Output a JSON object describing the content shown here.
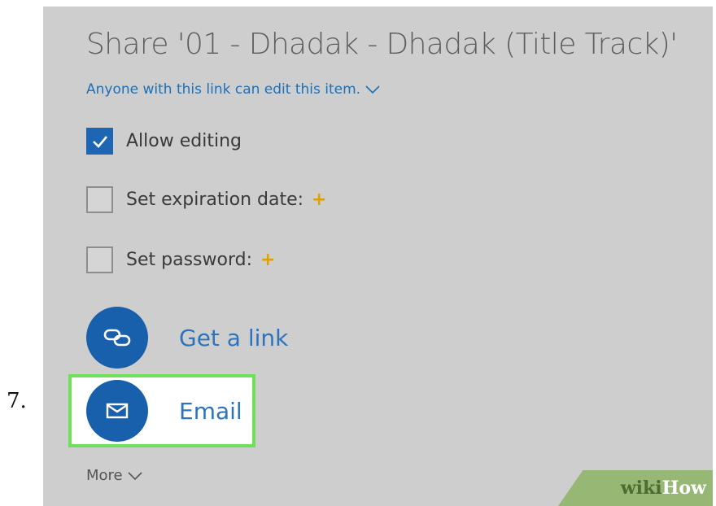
{
  "step_number": "7.",
  "dialog": {
    "title": "Share '01 - Dhadak - Dhadak (Title Track)'",
    "permission_text": "Anyone with this link can edit this item.",
    "options": [
      {
        "label": "Allow editing",
        "checked": true
      },
      {
        "label": "Set expiration date:",
        "checked": false,
        "premium": "+"
      },
      {
        "label": "Set password:",
        "checked": false,
        "premium": "+"
      }
    ],
    "actions": [
      {
        "label": "Get a link",
        "icon": "link-icon"
      },
      {
        "label": "Email",
        "icon": "envelope-icon",
        "highlighted": true
      }
    ],
    "more_label": "More"
  },
  "watermark": {
    "part1": "wiki",
    "part2": "How"
  },
  "colors": {
    "panel_background": "#cecece",
    "accent_blue": "#1960ac",
    "link_blue": "#1f6fb6",
    "highlight_green": "#6ee05a",
    "premium_gold": "#e0a000"
  }
}
